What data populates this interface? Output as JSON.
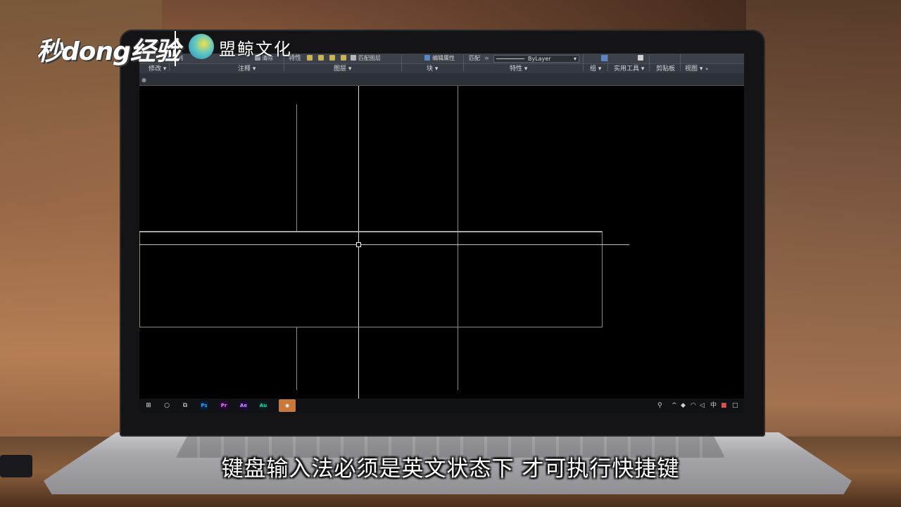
{
  "overlay": {
    "logo_left": "秒dong经验",
    "logo_right": "盟鲸文化",
    "subtitle": "键盘输入法必须是英文状态下 才可执行快捷键"
  },
  "ribbon": {
    "top_items": {
      "array": "阵列",
      "clear": "清除",
      "properties": "特性",
      "match_layer": "匹配图层",
      "edit_attributes": "编辑属性",
      "match": "匹配",
      "bylayer": "ByLayer"
    },
    "panels": {
      "modify": "修改 ▾",
      "annotation": "注释 ▾",
      "layers": "图层 ▾",
      "block": "块 ▾",
      "properties": "特性 ▾",
      "groups": "组 ▾",
      "utilities": "实用工具 ▾",
      "clipboard": "剪贴板",
      "view": "视图 ▾"
    }
  },
  "taskbar": {
    "apps": [
      "Ps",
      "Pr",
      "Ae",
      "Au"
    ]
  },
  "colors": {
    "ribbon_bg": "#3b4049",
    "canvas_bg": "#000000",
    "ps": "#31a8ff",
    "pr": "#e77bff",
    "ae": "#d291ff",
    "au": "#00e4bb"
  }
}
